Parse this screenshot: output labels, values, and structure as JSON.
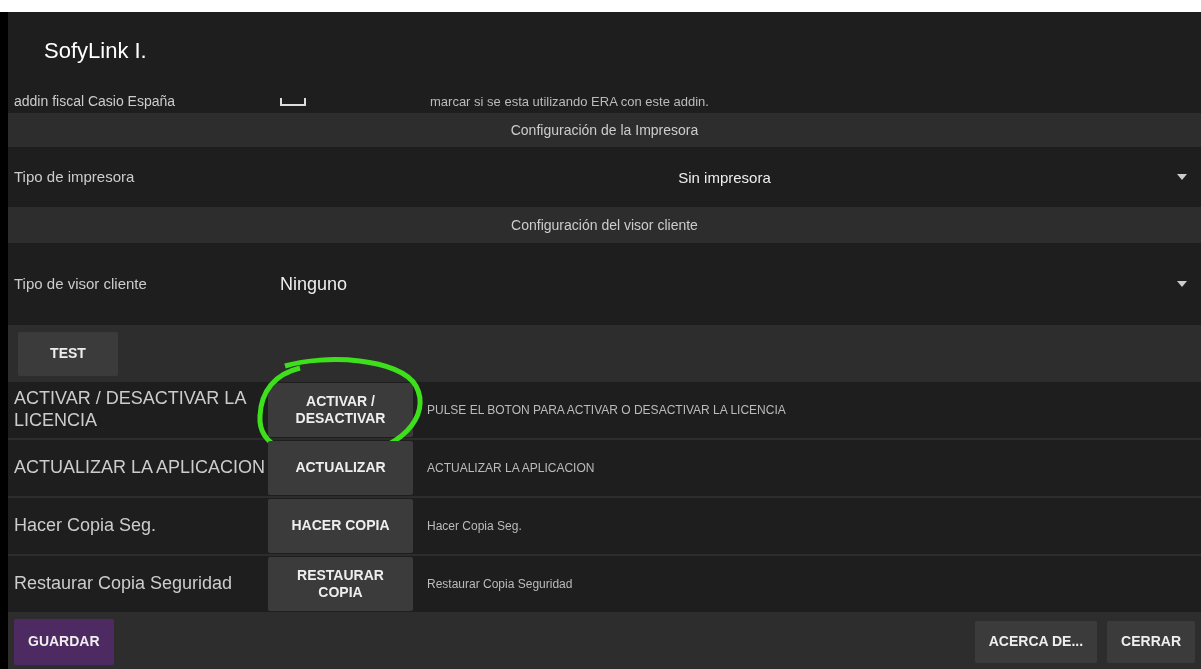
{
  "window": {
    "title": "SofyLink I."
  },
  "settings": [
    {
      "kind": "checkbox",
      "label": "addin fiscal Casio España",
      "checked": false,
      "description": "marcar si se esta utilizando ERA con este addin."
    },
    {
      "kind": "section",
      "title": "Configuración de la Impresora"
    },
    {
      "kind": "dropdown_centered",
      "label": "Tipo de impresora",
      "value": "Sin impresora"
    },
    {
      "kind": "section",
      "title": "Configuración del visor cliente"
    },
    {
      "kind": "dropdown",
      "label": "Tipo de visor cliente",
      "value": "Ninguno"
    },
    {
      "kind": "button_bar",
      "button": "TEST"
    }
  ],
  "actions": [
    {
      "label": "ACTIVAR / DESACTIVAR LA LICENCIA",
      "button": "ACTIVAR / DESACTIVAR",
      "description": "PULSE EL BOTON PARA ACTIVAR O DESACTIVAR LA LICENCIA",
      "highlighted": true
    },
    {
      "label": "ACTUALIZAR LA APLICACION",
      "button": "ACTUALIZAR",
      "description": "ACTUALIZAR LA APLICACION",
      "highlighted": false
    },
    {
      "label": "Hacer Copia Seg.",
      "button": "HACER COPIA",
      "description": "Hacer Copia Seg.",
      "highlighted": false
    },
    {
      "label": "Restaurar Copia Seguridad",
      "button": "RESTAURAR COPIA",
      "description": "Restaurar Copia Seguridad",
      "highlighted": false
    }
  ],
  "footer": {
    "primary": "GUARDAR",
    "buttons": [
      "ACERCA DE...",
      "CERRAR"
    ]
  }
}
